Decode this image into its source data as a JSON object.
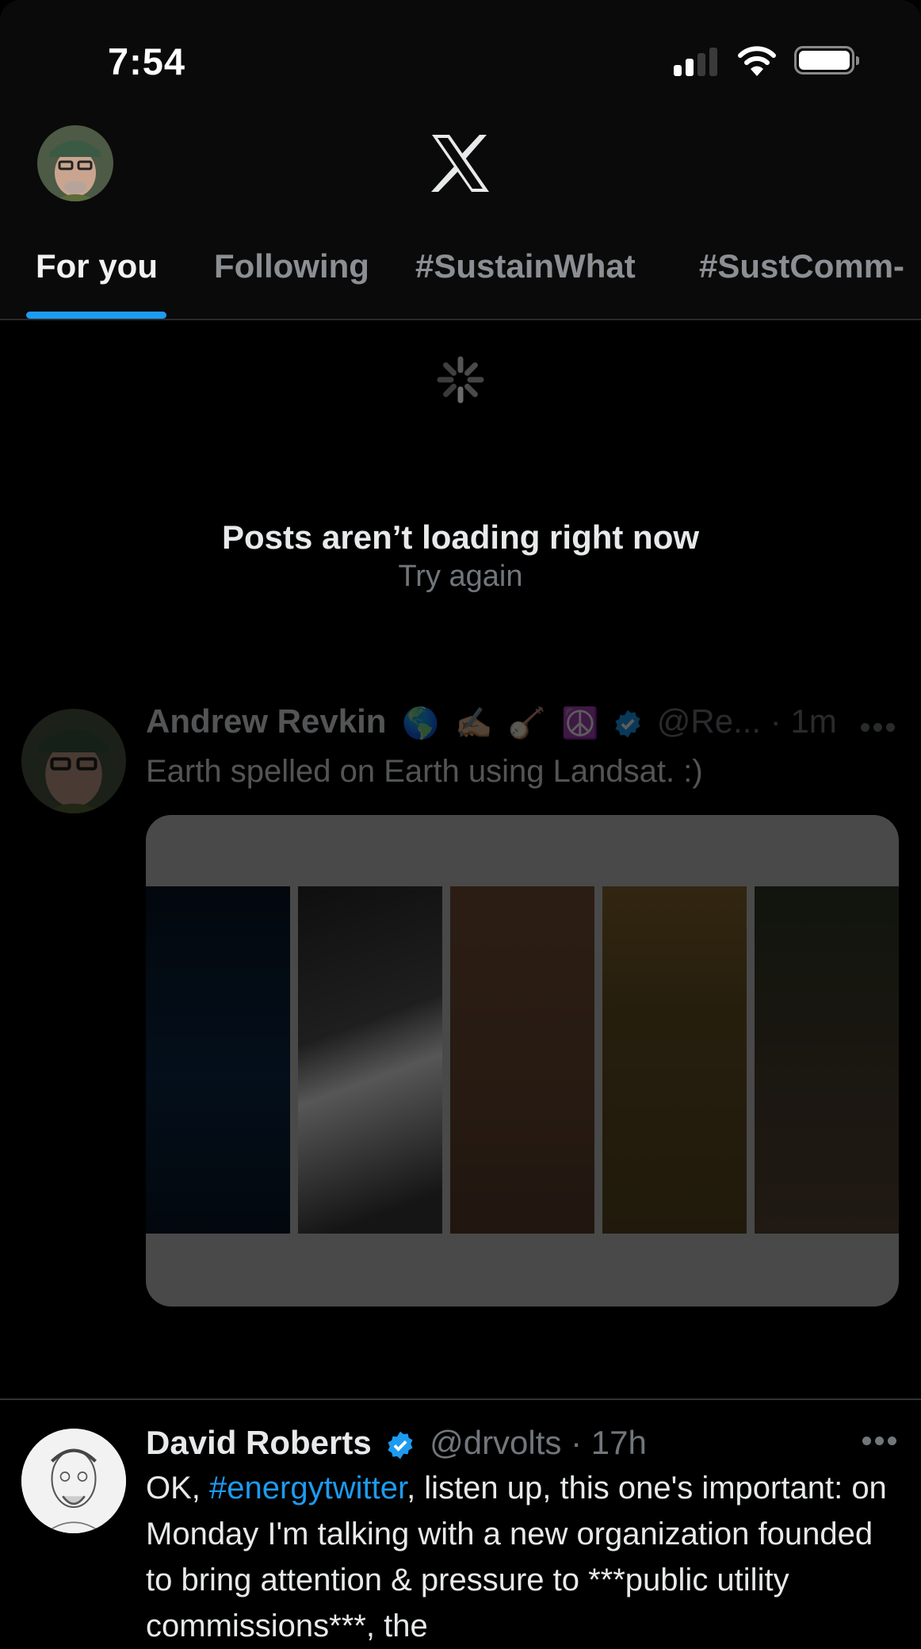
{
  "status_bar": {
    "time": "7:54",
    "signal_bars_active": 2,
    "signal_bars_total": 4,
    "wifi_icon": "wifi-icon",
    "battery_level": 1.0
  },
  "header": {
    "logo": "x-logo-icon",
    "avatar_alt": "profile-avatar"
  },
  "tabs": [
    {
      "label": "For you",
      "active": true
    },
    {
      "label": "Following",
      "active": false
    },
    {
      "label": "#SustainWhat",
      "active": false
    },
    {
      "label": "#SustComm-",
      "active": false
    }
  ],
  "feed_error": {
    "title": "Posts aren’t loading right now",
    "retry": "Try again"
  },
  "posts": [
    {
      "name": "Andrew Revkin",
      "name_emojis": [
        "🌎",
        "✍🏼",
        "🪕",
        "☮️"
      ],
      "verified": true,
      "handle": "@Re...",
      "separator": "·",
      "time": "1m",
      "text": "Earth spelled on Earth using Landsat. :)",
      "media": {
        "type": "image",
        "description": "Five satellite image strips spelling EARTH",
        "strip_colors": [
          "#0a1a2c",
          "#2a2a2a",
          "#6b4a33",
          "#6a5426",
          "#3c3a2a"
        ]
      },
      "dimmed": true
    },
    {
      "name": "David Roberts",
      "verified": true,
      "handle": "@drvolts",
      "separator": "·",
      "time": "17h",
      "text_before": "OK, ",
      "hashtag": "#energytwitter",
      "text_after": ", listen up, this one's important: on Monday I'm talking with a new organization founded to bring attention & pressure to ***public utility commissions***, the",
      "dimmed": false
    }
  ],
  "colors": {
    "accent": "#1d9bf0",
    "background": "#000000",
    "header_bg": "#0a0a0a",
    "muted_text": "#71767b",
    "primary_text": "#e7e9ea"
  }
}
